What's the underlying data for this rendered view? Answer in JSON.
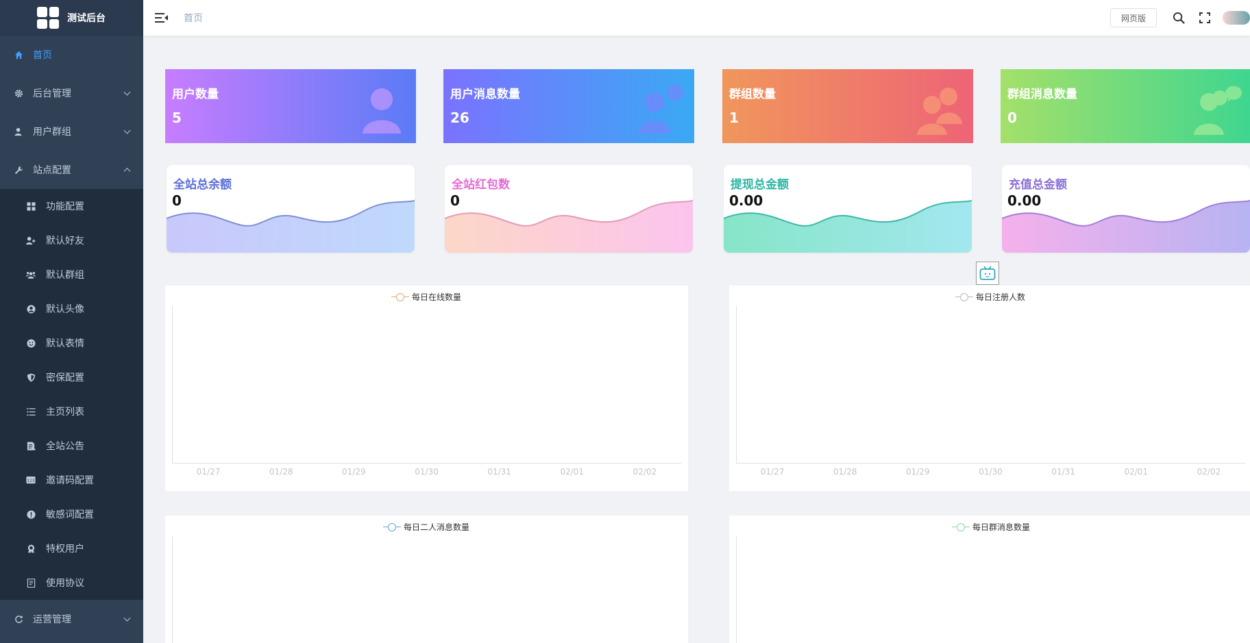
{
  "app": {
    "title": "测试后台"
  },
  "sidebar": {
    "items": [
      {
        "label": "首页",
        "icon": "home-icon",
        "active": true
      },
      {
        "label": "后台管理",
        "icon": "gear-icon"
      },
      {
        "label": "用户群组",
        "icon": "user-icon"
      },
      {
        "label": "站点配置",
        "icon": "wrench-icon",
        "expanded": true
      },
      {
        "label": "运营管理",
        "icon": "refresh-icon"
      }
    ],
    "submenu": [
      {
        "label": "功能配置",
        "icon": "grid-icon"
      },
      {
        "label": "默认好友",
        "icon": "user-add-icon"
      },
      {
        "label": "默认群组",
        "icon": "group-icon"
      },
      {
        "label": "默认头像",
        "icon": "avatar-icon"
      },
      {
        "label": "默认表情",
        "icon": "smile-icon"
      },
      {
        "label": "密保配置",
        "icon": "shield-icon"
      },
      {
        "label": "主页列表",
        "icon": "list-icon"
      },
      {
        "label": "全站公告",
        "icon": "notice-icon"
      },
      {
        "label": "邀请码配置",
        "icon": "code-icon"
      },
      {
        "label": "敏感词配置",
        "icon": "alert-icon"
      },
      {
        "label": "特权用户",
        "icon": "badge-icon"
      },
      {
        "label": "使用协议",
        "icon": "document-icon"
      }
    ]
  },
  "header": {
    "breadcrumb": "首页",
    "web_button": "网页版"
  },
  "stats": [
    {
      "label": "用户数量",
      "value": "5"
    },
    {
      "label": "用户消息数量",
      "value": "26"
    },
    {
      "label": "群组数量",
      "value": "1"
    },
    {
      "label": "群组消息数量",
      "value": "0"
    }
  ],
  "summary": [
    {
      "label": "全站总余额",
      "value": "0",
      "color": "#5b6fd8"
    },
    {
      "label": "全站红包数",
      "value": "0",
      "color": "#e36bd4"
    },
    {
      "label": "提现总金额",
      "value": "0.00",
      "color": "#2bb6a3"
    },
    {
      "label": "充值总金额",
      "value": "0.00",
      "color": "#8a6fd8"
    }
  ],
  "chart_data": [
    {
      "type": "line",
      "categories": [
        "01/27",
        "01/28",
        "01/29",
        "01/30",
        "01/31",
        "02/01",
        "02/02"
      ],
      "series": [
        {
          "name": "每日在线数量",
          "values": [],
          "color": "#e8a56f"
        }
      ]
    },
    {
      "type": "line",
      "categories": [
        "01/27",
        "01/28",
        "01/29",
        "01/30",
        "01/31",
        "02/01",
        "02/02"
      ],
      "series": [
        {
          "name": "每日注册人数",
          "values": [],
          "color": "#b0b8c4"
        }
      ]
    },
    {
      "type": "line",
      "categories": [],
      "series": [
        {
          "name": "每日二人消息数量",
          "values": [],
          "color": "#5aa8c8"
        }
      ]
    },
    {
      "type": "line",
      "categories": [],
      "series": [
        {
          "name": "每日群消息数量",
          "values": [],
          "color": "#8fd39a"
        }
      ]
    }
  ]
}
